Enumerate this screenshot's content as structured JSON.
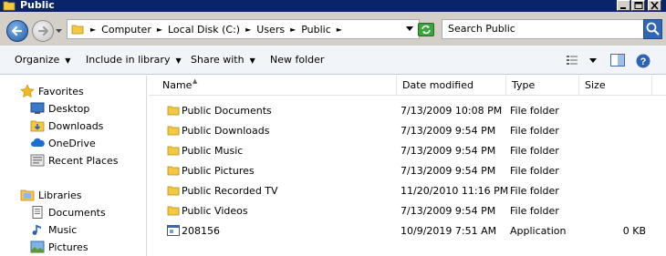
{
  "window": {
    "title": "Public"
  },
  "nav": {
    "path": [
      "Computer",
      "Local Disk (C:)",
      "Users",
      "Public"
    ],
    "search_placeholder": "Search Public"
  },
  "toolbar": {
    "organize": "Organize",
    "include_in_library": "Include in library",
    "share_with": "Share with",
    "new_folder": "New folder"
  },
  "sidebar": {
    "favorites": {
      "label": "Favorites",
      "items": [
        "Desktop",
        "Downloads",
        "OneDrive",
        "Recent Places"
      ]
    },
    "libraries": {
      "label": "Libraries",
      "items": [
        "Documents",
        "Music",
        "Pictures"
      ]
    }
  },
  "columns": [
    "Name",
    "Date modified",
    "Type",
    "Size"
  ],
  "files": [
    {
      "name": "Public Documents",
      "date": "7/13/2009 10:08 PM",
      "type": "File folder",
      "size": "",
      "icon": "folder-icon"
    },
    {
      "name": "Public Downloads",
      "date": "7/13/2009 9:54 PM",
      "type": "File folder",
      "size": "",
      "icon": "folder-icon"
    },
    {
      "name": "Public Music",
      "date": "7/13/2009 9:54 PM",
      "type": "File folder",
      "size": "",
      "icon": "folder-icon"
    },
    {
      "name": "Public Pictures",
      "date": "7/13/2009 9:54 PM",
      "type": "File folder",
      "size": "",
      "icon": "folder-icon"
    },
    {
      "name": "Public Recorded TV",
      "date": "11/20/2010 11:16 PM",
      "type": "File folder",
      "size": "",
      "icon": "folder-icon"
    },
    {
      "name": "Public Videos",
      "date": "7/13/2009 9:54 PM",
      "type": "File folder",
      "size": "",
      "icon": "folder-icon"
    },
    {
      "name": "208156",
      "date": "10/9/2019 7:51 AM",
      "type": "Application",
      "size": "0 KB",
      "icon": "application-icon"
    }
  ]
}
